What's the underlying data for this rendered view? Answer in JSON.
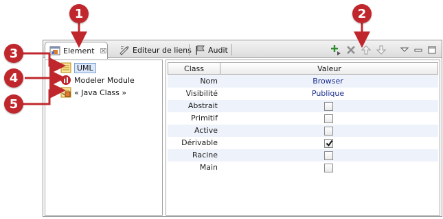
{
  "callouts": [
    "1",
    "2",
    "3",
    "4",
    "5"
  ],
  "tabs": [
    {
      "label": "Element",
      "icon": "element-icon",
      "active": true,
      "close": "☒"
    },
    {
      "label": "Editeur de liens",
      "icon": "link-editor-icon",
      "active": false
    },
    {
      "label": "Audit",
      "icon": "audit-flag-icon",
      "active": false
    }
  ],
  "toolbar": [
    "add-icon",
    "delete-icon",
    "move-up-icon",
    "move-down-icon",
    "view-menu-icon",
    "minimize-icon",
    "maximize-icon"
  ],
  "tree": [
    {
      "label": "UML",
      "icon": "uml-icon",
      "selected": true
    },
    {
      "label": "Modeler Module",
      "icon": "modeler-module-icon",
      "selected": false
    },
    {
      "label": "« Java Class »",
      "icon": "java-class-icon",
      "selected": false
    }
  ],
  "table": {
    "headers": [
      "Class",
      "Valeur"
    ],
    "rows": [
      {
        "key": "Nom",
        "value": "Browser",
        "type": "text"
      },
      {
        "key": "Visibilité",
        "value": "Publique",
        "type": "text"
      },
      {
        "key": "Abstrait",
        "checked": false,
        "type": "checkbox"
      },
      {
        "key": "Primitif",
        "checked": false,
        "type": "checkbox"
      },
      {
        "key": "Active",
        "checked": false,
        "type": "checkbox"
      },
      {
        "key": "Dérivable",
        "checked": true,
        "type": "checkbox"
      },
      {
        "key": "Racine",
        "checked": false,
        "type": "checkbox"
      },
      {
        "key": "Main",
        "checked": false,
        "type": "checkbox"
      }
    ]
  },
  "colors": {
    "callout": "#c0272d",
    "selection": "#dbe7fb",
    "value_text": "#1a2e8c"
  }
}
